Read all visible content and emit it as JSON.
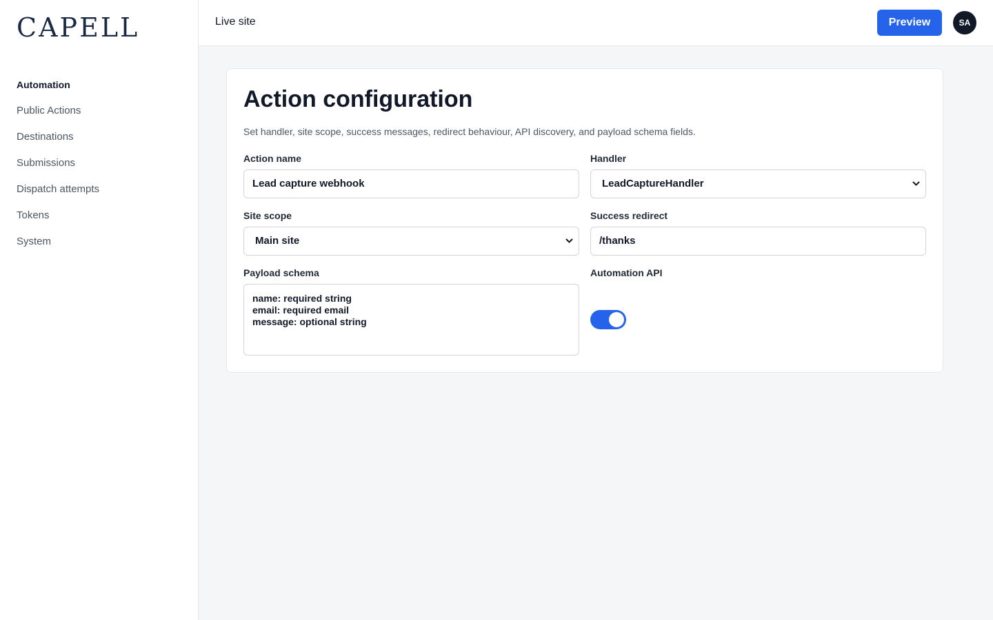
{
  "brand": {
    "logo_text": "CAPELL"
  },
  "sidebar": {
    "items": [
      {
        "label": "Automation",
        "active": true
      },
      {
        "label": "Public Actions"
      },
      {
        "label": "Destinations"
      },
      {
        "label": "Submissions"
      },
      {
        "label": "Dispatch attempts"
      },
      {
        "label": "Tokens"
      },
      {
        "label": "System"
      }
    ]
  },
  "topbar": {
    "title": "Live site",
    "preview_label": "Preview",
    "avatar_initials": "SA"
  },
  "card": {
    "title": "Action configuration",
    "description": "Set handler, site scope, success messages, redirect behaviour, API discovery, and payload schema fields.",
    "fields": {
      "action_name": {
        "label": "Action name",
        "value": "Lead capture webhook"
      },
      "handler": {
        "label": "Handler",
        "value": "LeadCaptureHandler"
      },
      "site_scope": {
        "label": "Site scope",
        "value": "Main site"
      },
      "success_redirect": {
        "label": "Success redirect",
        "value": "/thanks"
      },
      "payload_schema": {
        "label": "Payload schema",
        "value": "name: required string\nemail: required email\nmessage: optional string"
      },
      "automation_api": {
        "label": "Automation API",
        "enabled": true
      }
    }
  },
  "colors": {
    "accent": "#2563eb",
    "logo": "#1b2a44",
    "background": "#f5f6f8"
  }
}
